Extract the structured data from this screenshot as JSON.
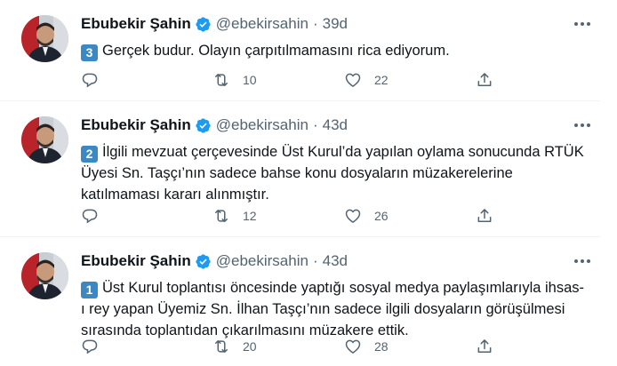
{
  "tweets": [
    {
      "name": "Ebubekir Şahin",
      "handle": "@ebekirsahin",
      "separator": "·",
      "age": "39d",
      "number": "3",
      "text": "Gerçek budur. Olayın çarpıtılmamasını rica ediyorum.",
      "replies": "",
      "retweets": "10",
      "likes": "22"
    },
    {
      "name": "Ebubekir Şahin",
      "handle": "@ebekirsahin",
      "separator": "·",
      "age": "43d",
      "number": "2",
      "text": "İlgili mevzuat çerçevesinde Üst Kurul’da yapılan oylama sonucunda RTÜK Üyesi Sn. Taşçı’nın sadece bahse konu dosyaların müzakerelerine katılmaması kararı alınmıştır.",
      "replies": "",
      "retweets": "12",
      "likes": "26"
    },
    {
      "name": "Ebubekir Şahin",
      "handle": "@ebekirsahin",
      "separator": "·",
      "age": "43d",
      "number": "1",
      "text": "Üst Kurul toplantısı öncesinde yaptığı sosyal medya paylaşımlarıyla ihsas-ı rey yapan Üyemiz Sn. İlhan Taşçı’nın sadece ilgili dosyaların görüşülmesi sırasında toplantıdan çıkarılmasını müzakere ettik.",
      "replies": "",
      "retweets": "20",
      "likes": "28"
    }
  ],
  "colors": {
    "verified": "#1d9bf0",
    "keycap": "#3b88c3",
    "secondary_text": "#536471",
    "divider": "#eff3f4"
  },
  "icons": [
    "verified-badge-icon",
    "more-options-icon",
    "reply-icon",
    "retweet-icon",
    "like-icon",
    "share-icon"
  ]
}
